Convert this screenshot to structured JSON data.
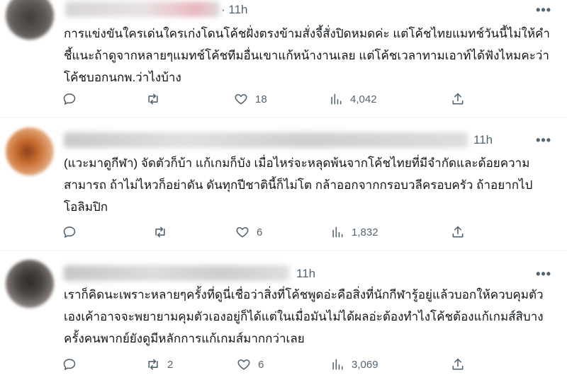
{
  "replies": [
    {
      "time": "· 11h",
      "text": "การแข่งขันใครเด่นใครเก่งโดนโค้ชฝั่งตรงข้ามสั่งจี้สั่งปิดหมดค่ะ แต่โค้ชไทยแมทช์วันนี้ไม่ให้คำชี้แนะถ้าดูจากหลายๆแมทช์โค้ชทีมอื่นเขาแก้หน้างานเลย แต่โค้ชเวลาทามเอาท์ได้ฟังไหมคะว่าโค้ชบอกนกพ.ว่าไงบ้าง",
      "more": "•••",
      "replies_count": "",
      "retweets": "",
      "likes": "18",
      "views": "4,042"
    },
    {
      "time": "11h",
      "text": "(แวะมาดูกีฬา) จัดตัวก็บ้า แก้เกมก็บัง เมื่อไหร่จะหลุดพ้นจากโค้ชไทยที่มีจำกัดและด้อยความสามารถ ถ้าไม่ไหวก็อย่าดัน ดันทุกปีชาตินี้ก็ไม่โต  กล้าออกจากกรอบวลีครอบครัว ถ้าอยากไปโอลิมปิก",
      "more": "•••",
      "replies_count": "",
      "retweets": "",
      "likes": "6",
      "views": "1,832"
    },
    {
      "time": "11h",
      "text": "เราก็คิดนะเพราะหลายๆครั้งที่ดูนี่เชื่อว่าสิ่งที่โค้ชพูดอ่ะคือสิ่งที่นักกีฬารู้อยู่แล้วบอกให้ควบคุมตัวเองเค้าอาจจะพยายามคุมตัวเองอยู่ก็ได้แต่ในเมื่อมันไม่ได้ผลอ่ะต้องทำไงโค้ชต้องแก้เกมส์สิบางครั้งคนพากย์ยังดูมีหลักการแก้เกมส์มากกว่าเลย",
      "more": "•••",
      "replies_count": "",
      "retweets": "2",
      "likes": "6",
      "views": "3,069"
    }
  ],
  "icons": {
    "reply": "reply-icon",
    "retweet": "retweet-icon",
    "like": "heart-icon",
    "views": "views-icon",
    "share": "share-icon"
  },
  "colors": {
    "text": "#0f1419",
    "muted": "#536471",
    "divider": "#eff3f4"
  }
}
